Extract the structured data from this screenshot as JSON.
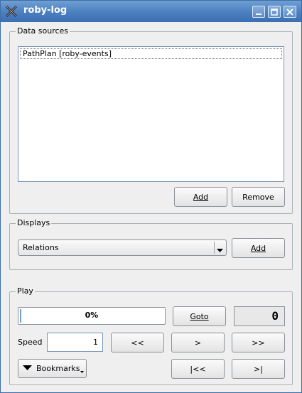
{
  "window": {
    "title": "roby-log"
  },
  "data_sources": {
    "title": "Data sources",
    "items": [
      "PathPlan [roby-events]"
    ],
    "add_label": "Add",
    "remove_label": "Remove"
  },
  "displays": {
    "title": "Displays",
    "selected": "Relations",
    "add_label": "Add"
  },
  "play": {
    "title": "Play",
    "progress": {
      "value": 0,
      "text": "0%"
    },
    "goto_label": "Goto",
    "lcd_value": "0",
    "speed_label": "Speed",
    "speed_value": "1",
    "btn_back": "<<",
    "btn_play": ">",
    "btn_forward": ">>",
    "bookmarks_label": "Bookmarks",
    "btn_start": "|<<",
    "btn_end": ">|"
  },
  "colors": {
    "titlebar": "#4a7fc0",
    "progress": "#6f9fd3"
  }
}
